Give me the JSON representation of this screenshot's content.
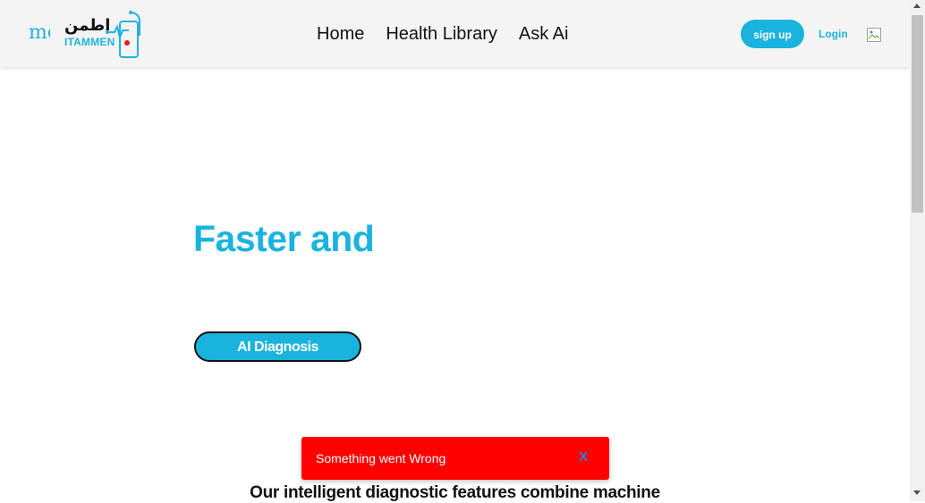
{
  "header": {
    "logo_cut_text": "me",
    "logo_arabic": "اطمن",
    "logo_latin": "ITAMMEN",
    "nav": [
      {
        "label": "Home"
      },
      {
        "label": "Health Library"
      },
      {
        "label": "Ask Ai"
      }
    ],
    "signup_label": "sign up",
    "login_label": "Login",
    "profile_icon": "broken-image-icon"
  },
  "hero": {
    "title": "Faster and",
    "cta_label": "AI Diagnosis"
  },
  "section": {
    "text": "Our intelligent diagnostic features combine machine"
  },
  "toast": {
    "message": "Something went Wrong",
    "close_label": "X"
  },
  "colors": {
    "accent": "#1ab3de",
    "toast_bg": "#ff0000",
    "navbar_bg": "#f4f4f4"
  }
}
